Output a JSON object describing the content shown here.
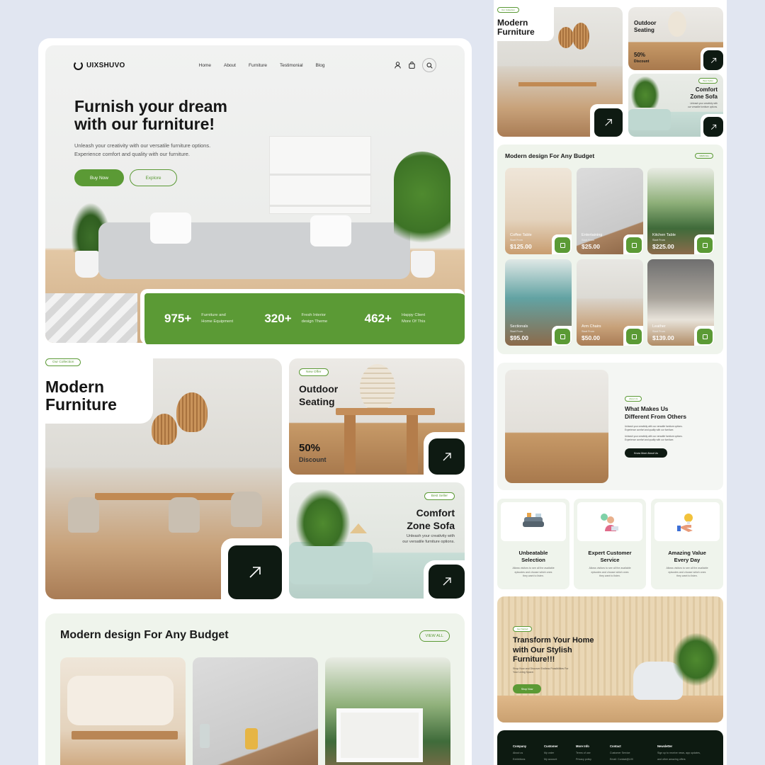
{
  "brand": {
    "name": "UIXSHUVO"
  },
  "nav": {
    "links": [
      "Home",
      "About",
      "Furniture",
      "Testimonial",
      "Blog"
    ]
  },
  "hero": {
    "title_line1": "Furnish your dream",
    "title_line2": "with our furniture!",
    "subtitle_line1": "Unleash your creativity with our versatile furniture options.",
    "subtitle_line2": "Experience comfort and quality with our furniture.",
    "buy_label": "Buy Now",
    "explore_label": "Explore"
  },
  "stats": [
    {
      "number": "975+",
      "label_line1": "Furniture and",
      "label_line2": "Home Equipment"
    },
    {
      "number": "320+",
      "label_line1": "Fresh Interior",
      "label_line2": "design Theme"
    },
    {
      "number": "462+",
      "label_line1": "Happy Client",
      "label_line2": "More Of This"
    }
  ],
  "collection": {
    "tag": "Our Collection",
    "title_line1": "Modern",
    "title_line2": "Furniture",
    "outdoor": {
      "tag": "New Offer",
      "title_line1": "Outdoor",
      "title_line2": "Seating",
      "discount_value": "50%",
      "discount_label": "Discount"
    },
    "comfort": {
      "tag": "Best Seller",
      "title_line1": "Comfort",
      "title_line2": "Zone Sofa",
      "subtitle_line1": "Unleash your creativity with",
      "subtitle_line2": "our versatile furniture options."
    }
  },
  "budget": {
    "title": "Modern design For Any Budget",
    "view_all": "VIEW ALL",
    "products": [
      {
        "name": "Coffee Table",
        "from": "Start From",
        "price": "$125.00"
      },
      {
        "name": "Entertaining",
        "from": "Start From",
        "price": "$25.00"
      },
      {
        "name": "Kitchen Table",
        "from": "Start From",
        "price": "$225.00"
      },
      {
        "name": "Sectionals",
        "from": "Start From",
        "price": "$95.00"
      },
      {
        "name": "Arm Chairs",
        "from": "Start From",
        "price": "$50.00"
      },
      {
        "name": "Leather",
        "from": "Start From",
        "price": "$139.00"
      }
    ]
  },
  "side": {
    "tag": "Our Collection",
    "budget_view_all": "VIEW ALL",
    "why": {
      "tag": "About Us",
      "title_line1": "What Makes Us",
      "title_line2": "Different From Others",
      "text1_line1": "Unleash your creativity with our versatile furniture options.",
      "text1_line2": "Experience comfort and quality with our furniture.",
      "text2_line1": "Unleash your creativity with our versatile furniture options.",
      "text2_line2": "Experience comfort and quality with our furniture.",
      "button": "Know More About Us"
    },
    "features": [
      {
        "title_line1": "Unbeatable",
        "title_line2": "Selection",
        "text_line1": "Allows visitors to see all the available",
        "text_line2": "episodes and choose which ones",
        "text_line3": "they want to listen."
      },
      {
        "title_line1": "Expert Customer",
        "title_line2": "Service",
        "text_line1": "Allows visitors to see all the available",
        "text_line2": "episodes and choose which ones",
        "text_line3": "they want to listen."
      },
      {
        "title_line1": "Amazing Value",
        "title_line2": "Every Day",
        "text_line1": "Allows visitors to see all the available",
        "text_line2": "episodes and choose which ones",
        "text_line3": "they want to listen."
      }
    ],
    "cta": {
      "tag": "Get Started",
      "title_line1": "Transform Your Home",
      "title_line2": "with Our Stylish",
      "title_line3": "Furniture!!!",
      "sub_line1": "Shop Now and Discover Endless Possibilities For",
      "sub_line2": "Your Living Space.",
      "button": "Shop Now"
    },
    "footer": {
      "columns": [
        {
          "head": "Company",
          "links": [
            "About us",
            "Exhibitions"
          ]
        },
        {
          "head": "Customer",
          "links": [
            "My order",
            "My account"
          ]
        },
        {
          "head": "More Info",
          "links": [
            "Terms of use",
            "Privacy policy"
          ]
        },
        {
          "head": "Contact",
          "links": [
            "Customer Service",
            "Email: Contact@UIX"
          ]
        },
        {
          "head": "Newsletter",
          "links": [
            "Sign up to receive news, app updates,",
            "and other amazing offers"
          ]
        }
      ]
    }
  },
  "colors": {
    "accent": "#5b9a35",
    "dark": "#0e1a12",
    "soft_green": "#eff4ec",
    "background": "#e1e6f1"
  },
  "icons": {
    "user": "user-icon",
    "cart": "bag-icon",
    "search": "search-icon",
    "arrow": "arrow-up-right-icon",
    "add_to_cart": "bag-icon"
  }
}
